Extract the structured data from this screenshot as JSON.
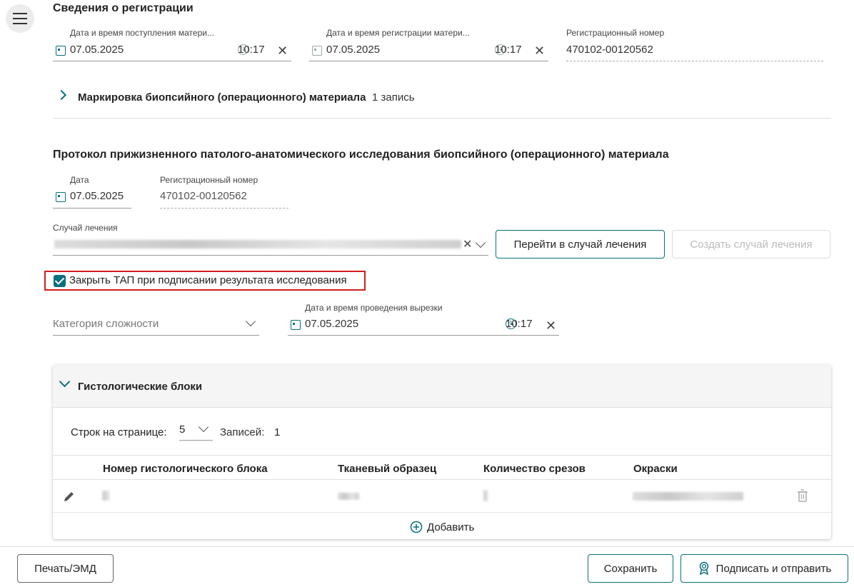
{
  "registration": {
    "title": "Сведения о регистрации",
    "receipt_label": "Дата и время поступления матери...",
    "receipt_date": "07.05.2025",
    "receipt_time": "10:17",
    "reg_label": "Дата и время регистрации матери...",
    "reg_date": "07.05.2025",
    "reg_time": "10:17",
    "number_label": "Регистрационный номер",
    "number_value": "470102-00120562"
  },
  "marking": {
    "title": "Маркировка биопсийного (операционного) материала",
    "count": "1 запись"
  },
  "protocol": {
    "title": "Протокол прижизненного патолого-анатомического исследования биопсийного (операционного) материала",
    "date_label": "Дата",
    "date_value": "07.05.2025",
    "number_label": "Регистрационный номер",
    "number_value": "470102-00120562",
    "case_label": "Случай лечения",
    "goto_case_button": "Перейти в случай лечения",
    "create_case_button": "Создать случай лечения",
    "close_tap_label": "Закрыть ТАП при подписании результата исследования",
    "complexity_placeholder": "Категория сложности",
    "cut_label": "Дата и время проведения вырезки",
    "cut_date": "07.05.2025",
    "cut_time": "10:17"
  },
  "histology": {
    "title": "Гистологические блоки",
    "rows_per_page_label": "Строк на странице:",
    "rows_per_page_value": "5",
    "records_label": "Записей:",
    "records_value": "1",
    "columns": [
      "Номер гистологического блока",
      "Тканевый образец",
      "Количество срезов",
      "Окраски"
    ],
    "add_button": "Добавить"
  },
  "footer": {
    "print_button": "Печать/ЭМД",
    "save_button": "Сохранить",
    "sign_button": "Подписать и отправить"
  },
  "colors": {
    "accent": "#0a6f7f",
    "highlight": "#d21f1f"
  },
  "icons": [
    "menu-icon",
    "calendar-icon",
    "clock-icon",
    "close-icon",
    "chevron-right-icon",
    "chevron-down-icon",
    "checkbox-icon",
    "edit-icon",
    "trash-icon",
    "plus-circle-icon",
    "signature-icon"
  ]
}
